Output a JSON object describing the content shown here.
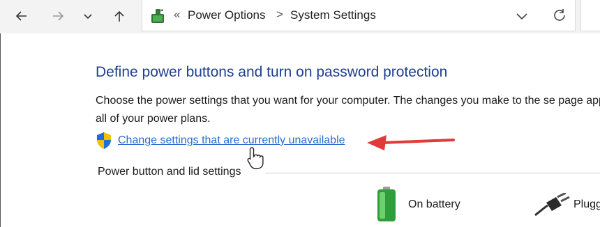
{
  "address_bar": {
    "overflow": "«",
    "breadcrumbs": [
      "Power Options",
      "System Settings"
    ],
    "separator": ">"
  },
  "page": {
    "heading": "Define power buttons and turn on password protection",
    "description": "Choose the power settings that you want for your computer. The changes you make to the se page apply to all of your power plans.",
    "admin_link": "Change settings that are currently unavailable",
    "group_label": "Power button and lid settings",
    "columns": [
      "On battery",
      "Plugged in"
    ]
  },
  "icons": {
    "back": "back-arrow-icon",
    "forward": "forward-arrow-icon",
    "recent": "chevron-down-icon",
    "up": "up-arrow-icon",
    "location": "power-options-icon",
    "dropdown": "chevron-down-icon",
    "refresh": "refresh-icon",
    "shield": "uac-shield-icon",
    "battery": "battery-icon",
    "plug": "plug-icon"
  },
  "colors": {
    "heading": "#1f3f8f",
    "link": "#2a6bd1",
    "annotation_arrow": "#e03a3a"
  }
}
